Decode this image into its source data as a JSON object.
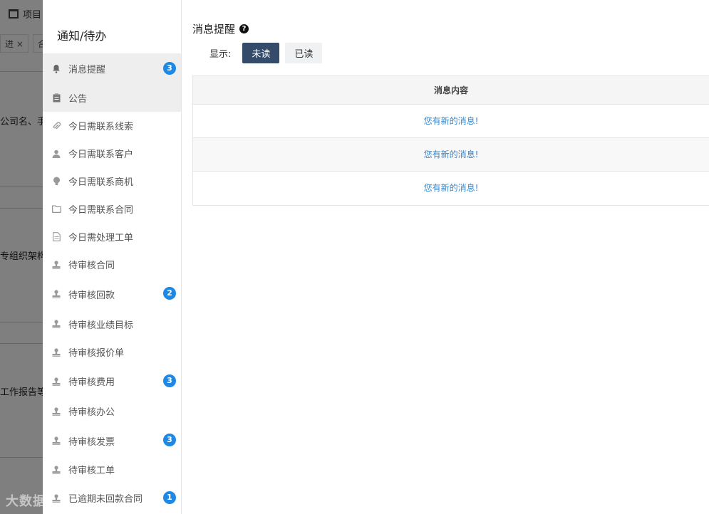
{
  "background": {
    "header_title": "项目",
    "tabs": [
      "进 ×",
      "合"
    ],
    "labels": [
      "公司名、手",
      "专组织架构",
      "工作报告等"
    ]
  },
  "drawer": {
    "sidebar_title": "通知/待办",
    "items": [
      {
        "label": "消息提醒",
        "icon": "bell-icon",
        "badge": "3",
        "active": true
      },
      {
        "label": "公告",
        "icon": "clipboard-icon",
        "badge": null,
        "active": true
      },
      {
        "label": "今日需联系线索",
        "icon": "paperclip-icon",
        "badge": null
      },
      {
        "label": "今日需联系客户",
        "icon": "user-icon",
        "badge": null
      },
      {
        "label": "今日需联系商机",
        "icon": "lightbulb-icon",
        "badge": null
      },
      {
        "label": "今日需联系合同",
        "icon": "folder-icon",
        "badge": null
      },
      {
        "label": "今日需处理工单",
        "icon": "document-icon",
        "badge": null
      },
      {
        "label": "待审核合同",
        "icon": "stamp-icon",
        "badge": null
      },
      {
        "label": "待审核回款",
        "icon": "stamp-icon",
        "badge": "2"
      },
      {
        "label": "待审核业绩目标",
        "icon": "stamp-icon",
        "badge": null
      },
      {
        "label": "待审核报价单",
        "icon": "stamp-icon",
        "badge": null
      },
      {
        "label": "待审核费用",
        "icon": "stamp-icon",
        "badge": "3"
      },
      {
        "label": "待审核办公",
        "icon": "stamp-icon",
        "badge": null
      },
      {
        "label": "待审核发票",
        "icon": "stamp-icon",
        "badge": "3"
      },
      {
        "label": "待审核工单",
        "icon": "stamp-icon",
        "badge": null
      },
      {
        "label": "已逾期未回款合同",
        "icon": "stamp-icon",
        "badge": "1"
      }
    ],
    "main_title": "消息提醒",
    "filter_label": "显示:",
    "filter_unread": "未读",
    "filter_read": "已读",
    "table_header": "消息内容",
    "rows": [
      "您有新的消息!",
      "您有新的消息!",
      "您有新的消息!"
    ]
  },
  "watermark": "大数据"
}
